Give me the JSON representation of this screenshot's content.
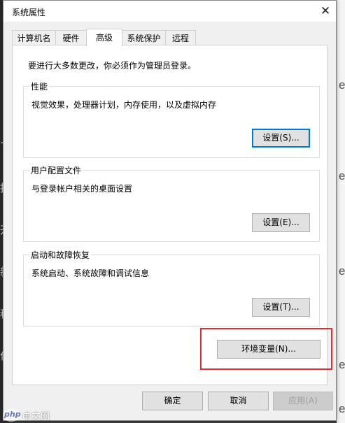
{
  "window": {
    "title": "系统属性",
    "close_glyph": "✕"
  },
  "tabs": [
    {
      "label": "计算机名",
      "active": false
    },
    {
      "label": "硬件",
      "active": false
    },
    {
      "label": "高级",
      "active": true
    },
    {
      "label": "系统保护",
      "active": false
    },
    {
      "label": "远程",
      "active": false
    }
  ],
  "intro_text": "要进行大多数更改，你必须作为管理员登录。",
  "groups": {
    "performance": {
      "title": "性能",
      "description": "视觉效果，处理器计划，内存使用，以及虚拟内存",
      "button": "设置(S)..."
    },
    "user_profiles": {
      "title": "用户配置文件",
      "description": "与登录帐户相关的桌面设置",
      "button": "设置(E)..."
    },
    "startup_recovery": {
      "title": "启动和故障恢复",
      "description": "系统启动、系统故障和调试信息",
      "button": "设置(T)..."
    }
  },
  "env_button": "环境变量(N)...",
  "footer": {
    "ok": "确定",
    "cancel": "取消",
    "apply": "应用(A)"
  },
  "watermark": {
    "logo": "php",
    "text": "中文网"
  },
  "background_fragments": {
    "left": [
      "+",
      "指",
      "开",
      "新",
      "程",
      "价"
    ],
    "right": [
      "e",
      "e",
      "e",
      "e",
      "e"
    ]
  },
  "colors": {
    "highlight_border": "#e02e2e",
    "focus_border": "#0078d7",
    "dialog_bg": "#f0f0f0",
    "panel_bg": "#ffffff"
  }
}
